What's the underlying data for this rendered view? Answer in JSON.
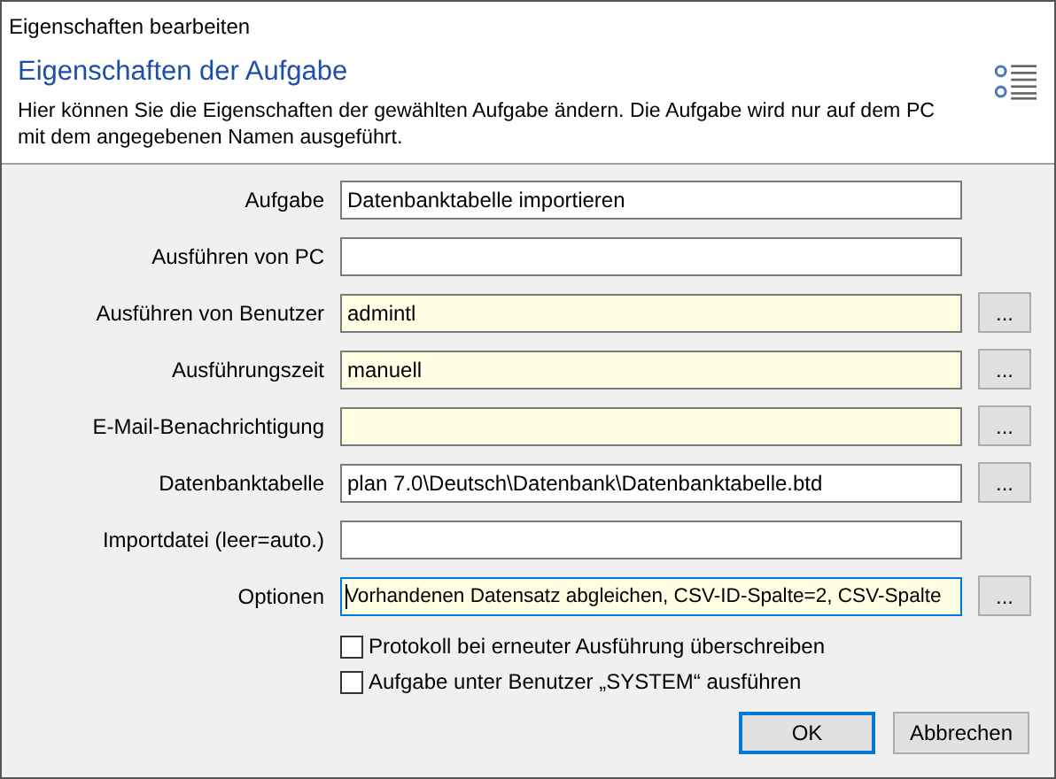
{
  "window": {
    "title": "Eigenschaften bearbeiten"
  },
  "header": {
    "title": "Eigenschaften der Aufgabe",
    "description": "Hier können Sie die Eigenschaften der gewählten Aufgabe ändern. Die Aufgabe wird nur auf dem PC mit dem angegebenen Namen ausgeführt."
  },
  "fields": [
    {
      "label": "Aufgabe",
      "value": "Datenbanktabelle importieren",
      "highlighted": false,
      "focused": false
    },
    {
      "label": "Ausführen von PC",
      "highlighted": false,
      "focused": false
    },
    {
      "label": "Ausführen von Benutzer",
      "value": "admintl",
      "highlighted": true,
      "focused": false,
      "browse_button": "..."
    },
    {
      "label": "Ausführungszeit",
      "value": "manuell",
      "highlighted": true,
      "focused": false,
      "browse_button": "..."
    },
    {
      "label": "E-Mail-Benachrichtigung",
      "highlighted": true,
      "focused": false,
      "browse_button": "..."
    },
    {
      "label": "Datenbanktabelle",
      "value": "plan 7.0\\Deutsch\\Datenbank\\Datenbanktabelle.btd",
      "highlighted": false,
      "focused": false,
      "browse_button": "..."
    },
    {
      "label": "Importdatei (leer=auto.)",
      "highlighted": false,
      "focused": false
    },
    {
      "label": "Optionen",
      "value": "Vorhandenen Datensatz abgleichen, CSV-ID-Spalte=2, CSV-Spalte",
      "highlighted": true,
      "focused": true,
      "browse_button": "..."
    }
  ],
  "checkboxes": [
    {
      "label": "Protokoll bei erneuter Ausführung überschreiben",
      "checked": false
    },
    {
      "label": "Aufgabe unter Benutzer „SYSTEM“ ausführen",
      "checked": false
    }
  ],
  "buttons": [
    {
      "label": "OK",
      "default": true
    },
    {
      "label": "Abbrechen",
      "default": false
    }
  ]
}
